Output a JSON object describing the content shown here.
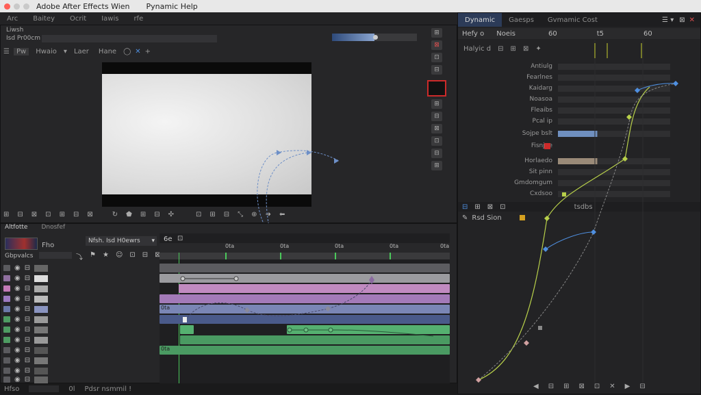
{
  "window": {
    "title": "Adobe After Effects Wien",
    "help_menu": "Pynamic Help",
    "traffic_colors": [
      "#ff5f57",
      "#c9c9c9",
      "#c9c9c9"
    ]
  },
  "menubar": {
    "items": [
      "Arc",
      "Baitey",
      "Ocrit",
      "Iawis",
      "rfe"
    ]
  },
  "viewer": {
    "label_top": "Liwsh",
    "subtitle": "Isd Pr00cm",
    "tool_items": [
      "Pw",
      "Hwaio",
      "Laer",
      "Hane"
    ],
    "progress_fraction": 0.5
  },
  "timeline": {
    "tabs": [
      "Altfotte",
      "Dnosfef"
    ],
    "comp_label": "Fho",
    "dropdown_label": "Nfsh. Isd H0ewrs",
    "search_label": "Gbpvalcs",
    "time_label": "6e",
    "ruler_ticks": [
      "0ta",
      "0ta",
      "0ta",
      "0ta",
      "0ta"
    ]
  },
  "layers": {
    "colors": [
      "#5a5a5e",
      "#8f6f9f",
      "#c37ab8",
      "#9d7ac0",
      "#6b78a8",
      "#4e9c62",
      "#4e9c62",
      "#4e9c62",
      "#5a5a5e",
      "#5a5a5e",
      "#5a5a5e",
      "#5a5a5e"
    ],
    "bar_labels": [
      "0ta",
      "0ta"
    ]
  },
  "status": {
    "left": "Hfso",
    "mid": "0l",
    "right": "Pdsr nsmmil !"
  },
  "dynamic_panel": {
    "tabs": [
      "Dynamic",
      "Gaesps",
      "Gvmamic Cost"
    ],
    "header": {
      "title": "Hefy o",
      "col1": "Noeis",
      "col2": "60",
      "col3": "t5",
      "col4": "60"
    },
    "subheader": "Halyic d",
    "properties": [
      "Antiulg",
      "Fearlnes",
      "Kaidarg",
      "Noasoa",
      "Fleaibs",
      "Pcal ip",
      "Sojpe bslt",
      "Fisnjge",
      "Horlaedo",
      "Sit pinn",
      "Gmdomgum",
      "Cxdsoo"
    ],
    "graph_title": "Rsd Sion",
    "bottom_tag": "tsdbs"
  }
}
